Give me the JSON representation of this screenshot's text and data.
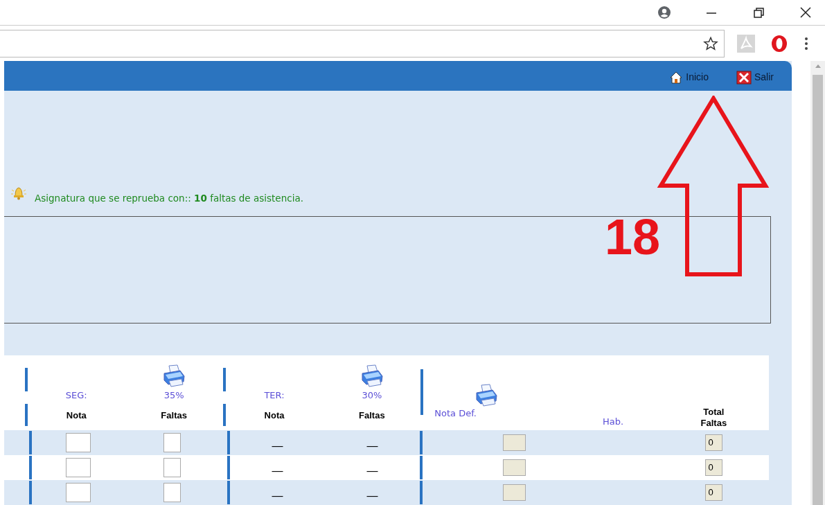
{
  "nav_links": [
    {
      "kind": "home",
      "label": "Inicio"
    },
    {
      "kind": "exit",
      "label": "Salir"
    }
  ],
  "notice": "Asignatura que se reprueba con:: **10** faltas de asistencia.",
  "annotation": {
    "label": "18"
  },
  "table": {
    "groups": [
      {
        "label": "SEG:",
        "weight": "35%",
        "columns": [
          "Nota",
          "Faltas"
        ]
      },
      {
        "label": "TER:",
        "weight": "30%",
        "columns": [
          "Nota",
          "Faltas"
        ]
      }
    ],
    "final_columns": {
      "nota_def": "Nota Def.",
      "hab": "Hab.",
      "total": "Total Faltas"
    },
    "rows": [
      {
        "kind": "editable",
        "ter": [
          "—",
          "—"
        ],
        "total_faltas": "0"
      },
      {
        "kind": "editable",
        "ter": [
          "—",
          "—"
        ],
        "total_faltas": "0"
      },
      {
        "kind": "editable",
        "ter": [
          "—",
          "—"
        ],
        "total_faltas": "0"
      }
    ]
  }
}
